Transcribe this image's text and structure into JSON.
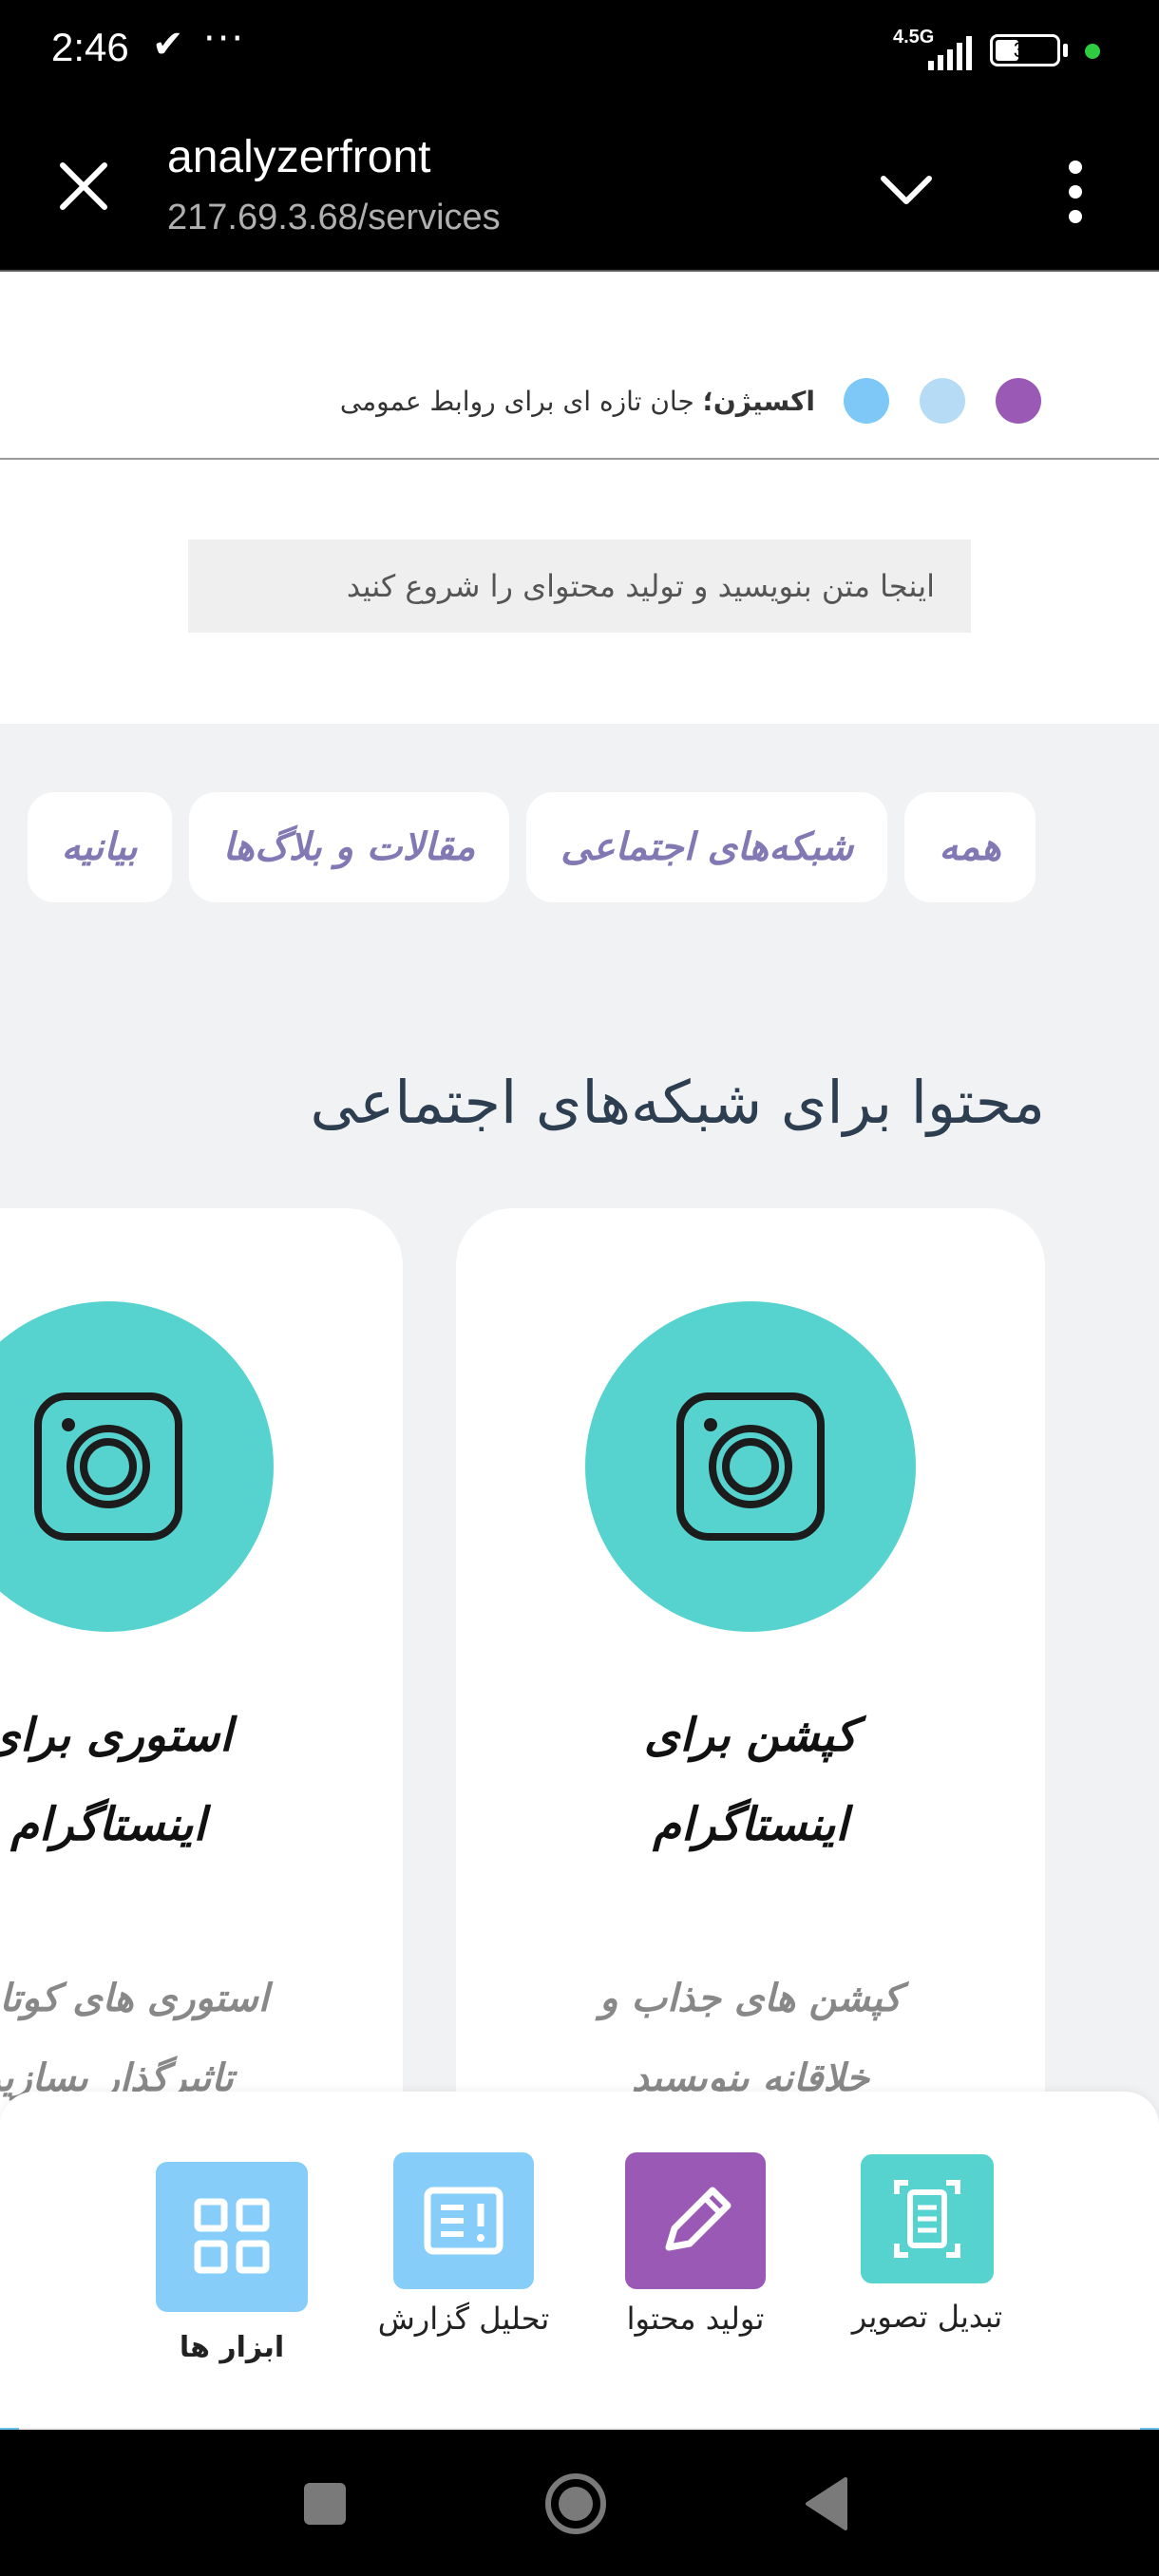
{
  "status_bar": {
    "time": "2:46",
    "check": "✔",
    "dots": "···",
    "network_type": "4.5G",
    "battery_level": "33"
  },
  "browser": {
    "site_title": "analyzerfront",
    "url": "217.69.3.68/services"
  },
  "brand": {
    "name": "اکسیژن؛",
    "tagline": " جان تازه ای برای روابط عمومی",
    "dot_colors": [
      "#9b59b6",
      "#b6dcf5",
      "#7ec8f7"
    ]
  },
  "prompt": {
    "placeholder": "اینجا متن بنویسید و تولید محتوای را شروع کنید"
  },
  "tabs": [
    "همه",
    "شبکه‌های اجتماعی",
    "مقالات و بلاگ‌ها",
    "بیانیه"
  ],
  "section": {
    "title": "محتوا برای شبکه‌های اجتماعی"
  },
  "cards": [
    {
      "icon": "instagram-icon",
      "title_line1": "کپشن برای",
      "title_line2": "اینستاگرام",
      "desc_line1": "کپشن های جذاب و",
      "desc_line2": "خلاقانه بنویسید"
    },
    {
      "icon": "instagram-icon",
      "title_line1": "استوری برای",
      "title_line2": "اینستاگرام",
      "desc_line1": "استوری های کوتاه و",
      "desc_line2": "تاثیرگذار بسازید"
    }
  ],
  "bottom_tools": [
    {
      "label": "تبدیل تصویر",
      "icon": "scan-document-icon",
      "color": "#56d3cf"
    },
    {
      "label": "تولید محتوا",
      "icon": "pencil-icon",
      "color": "#9b59b6"
    },
    {
      "label": "تحلیل گزارش",
      "icon": "report-icon",
      "color": "#86cdf9"
    },
    {
      "label": "ابزار ها",
      "icon": "grid-icon",
      "color": "#86cdf9"
    }
  ],
  "colors": {
    "accent_teal": "#56d3cf",
    "tab_text": "#8279b4",
    "title_text": "#2c3e50"
  }
}
